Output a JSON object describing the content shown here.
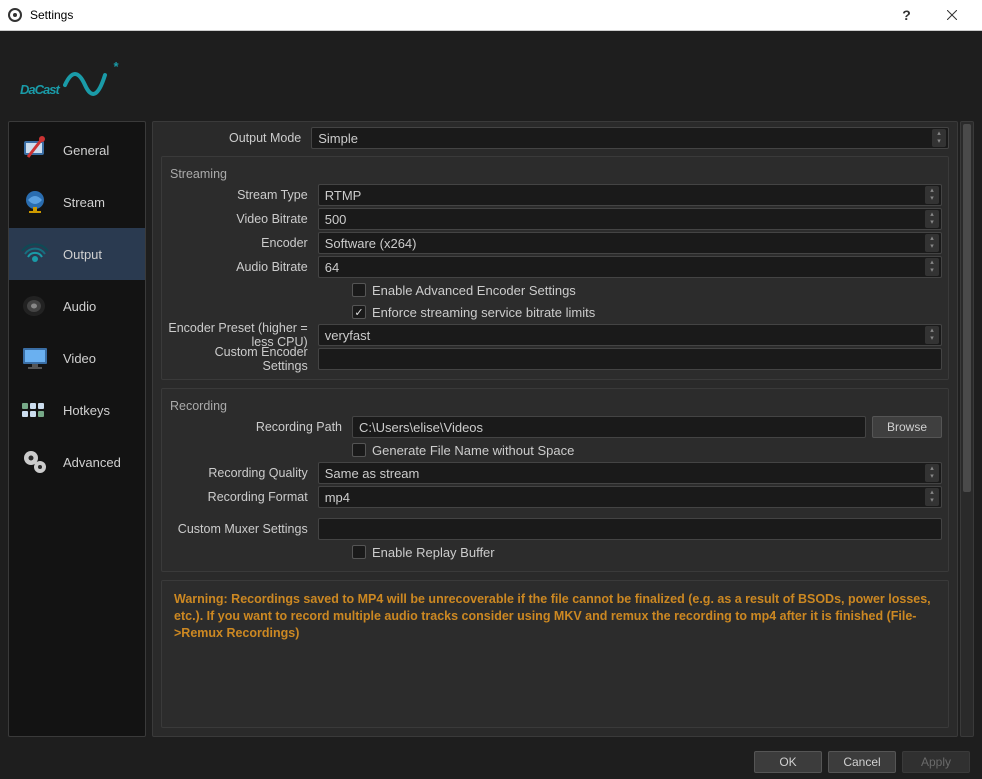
{
  "window": {
    "title": "Settings"
  },
  "brand": {
    "name": "DaCast"
  },
  "sidebar": {
    "items": [
      {
        "label": "General"
      },
      {
        "label": "Stream"
      },
      {
        "label": "Output"
      },
      {
        "label": "Audio"
      },
      {
        "label": "Video"
      },
      {
        "label": "Hotkeys"
      },
      {
        "label": "Advanced"
      }
    ],
    "active_index": 2
  },
  "form": {
    "output_mode": {
      "label": "Output Mode",
      "value": "Simple"
    },
    "streaming": {
      "heading": "Streaming",
      "stream_type": {
        "label": "Stream Type",
        "value": "RTMP"
      },
      "video_bitrate": {
        "label": "Video Bitrate",
        "value": "500"
      },
      "encoder": {
        "label": "Encoder",
        "value": "Software (x264)"
      },
      "audio_bitrate": {
        "label": "Audio Bitrate",
        "value": "64"
      },
      "advanced_checkbox": {
        "label": "Enable Advanced Encoder Settings",
        "checked": false
      },
      "enforce_checkbox": {
        "label": "Enforce streaming service bitrate limits",
        "checked": true
      },
      "preset": {
        "label": "Encoder Preset (higher = less CPU)",
        "value": "veryfast"
      },
      "custom_encoder": {
        "label": "Custom Encoder Settings",
        "value": ""
      }
    },
    "recording": {
      "heading": "Recording",
      "path": {
        "label": "Recording Path",
        "value": "C:\\Users\\elise\\Videos",
        "browse": "Browse"
      },
      "filename_checkbox": {
        "label": "Generate File Name without Space",
        "checked": false
      },
      "quality": {
        "label": "Recording Quality",
        "value": "Same as stream"
      },
      "format": {
        "label": "Recording Format",
        "value": "mp4"
      },
      "custom_muxer": {
        "label": "Custom Muxer Settings",
        "value": ""
      },
      "replay_checkbox": {
        "label": "Enable Replay Buffer",
        "checked": false
      }
    },
    "warning": "Warning: Recordings saved to MP4 will be unrecoverable if the file cannot be finalized (e.g. as a result of BSODs, power losses, etc.). If you want to record multiple audio tracks consider using MKV and remux the recording to mp4 after it is finished (File->Remux Recordings)"
  },
  "footer": {
    "ok": "OK",
    "cancel": "Cancel",
    "apply": "Apply"
  }
}
